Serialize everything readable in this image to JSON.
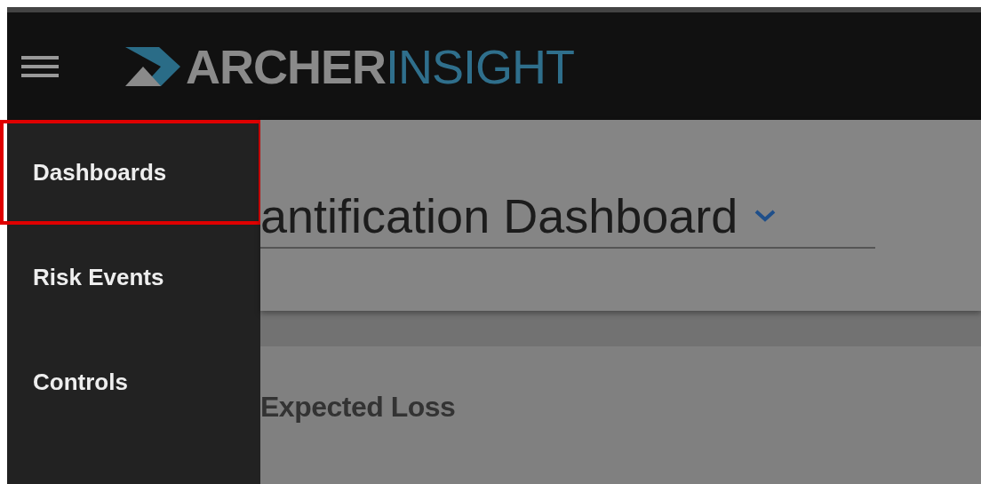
{
  "header": {
    "logo": {
      "word_1": "ARCHER",
      "word_2": "INSIGHT"
    }
  },
  "nav_menu": {
    "items": [
      {
        "label": "Dashboards",
        "highlighted": true
      },
      {
        "label": "Risk Events",
        "highlighted": false
      },
      {
        "label": "Controls",
        "highlighted": false
      }
    ]
  },
  "dashboard": {
    "title": "antification Dashboard",
    "card_title": "Expected Loss"
  }
}
